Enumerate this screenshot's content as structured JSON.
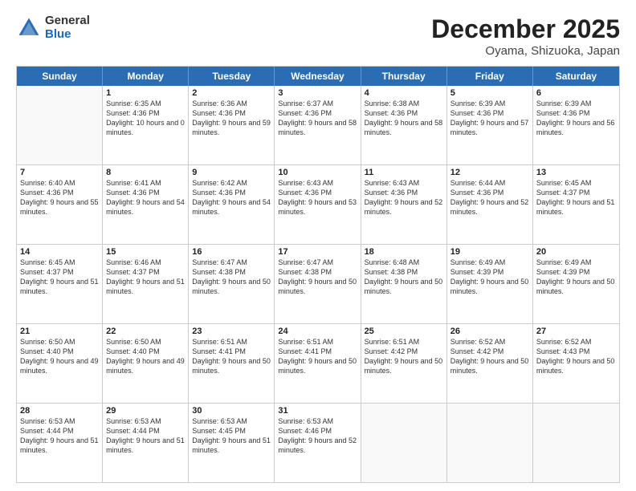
{
  "logo": {
    "general": "General",
    "blue": "Blue"
  },
  "title": "December 2025",
  "location": "Oyama, Shizuoka, Japan",
  "dayHeaders": [
    "Sunday",
    "Monday",
    "Tuesday",
    "Wednesday",
    "Thursday",
    "Friday",
    "Saturday"
  ],
  "weeks": [
    [
      {
        "day": "",
        "empty": true
      },
      {
        "day": "1",
        "sunrise": "Sunrise: 6:35 AM",
        "sunset": "Sunset: 4:36 PM",
        "daylight": "Daylight: 10 hours and 0 minutes."
      },
      {
        "day": "2",
        "sunrise": "Sunrise: 6:36 AM",
        "sunset": "Sunset: 4:36 PM",
        "daylight": "Daylight: 9 hours and 59 minutes."
      },
      {
        "day": "3",
        "sunrise": "Sunrise: 6:37 AM",
        "sunset": "Sunset: 4:36 PM",
        "daylight": "Daylight: 9 hours and 58 minutes."
      },
      {
        "day": "4",
        "sunrise": "Sunrise: 6:38 AM",
        "sunset": "Sunset: 4:36 PM",
        "daylight": "Daylight: 9 hours and 58 minutes."
      },
      {
        "day": "5",
        "sunrise": "Sunrise: 6:39 AM",
        "sunset": "Sunset: 4:36 PM",
        "daylight": "Daylight: 9 hours and 57 minutes."
      },
      {
        "day": "6",
        "sunrise": "Sunrise: 6:39 AM",
        "sunset": "Sunset: 4:36 PM",
        "daylight": "Daylight: 9 hours and 56 minutes."
      }
    ],
    [
      {
        "day": "7",
        "sunrise": "Sunrise: 6:40 AM",
        "sunset": "Sunset: 4:36 PM",
        "daylight": "Daylight: 9 hours and 55 minutes."
      },
      {
        "day": "8",
        "sunrise": "Sunrise: 6:41 AM",
        "sunset": "Sunset: 4:36 PM",
        "daylight": "Daylight: 9 hours and 54 minutes."
      },
      {
        "day": "9",
        "sunrise": "Sunrise: 6:42 AM",
        "sunset": "Sunset: 4:36 PM",
        "daylight": "Daylight: 9 hours and 54 minutes."
      },
      {
        "day": "10",
        "sunrise": "Sunrise: 6:43 AM",
        "sunset": "Sunset: 4:36 PM",
        "daylight": "Daylight: 9 hours and 53 minutes."
      },
      {
        "day": "11",
        "sunrise": "Sunrise: 6:43 AM",
        "sunset": "Sunset: 4:36 PM",
        "daylight": "Daylight: 9 hours and 52 minutes."
      },
      {
        "day": "12",
        "sunrise": "Sunrise: 6:44 AM",
        "sunset": "Sunset: 4:36 PM",
        "daylight": "Daylight: 9 hours and 52 minutes."
      },
      {
        "day": "13",
        "sunrise": "Sunrise: 6:45 AM",
        "sunset": "Sunset: 4:37 PM",
        "daylight": "Daylight: 9 hours and 51 minutes."
      }
    ],
    [
      {
        "day": "14",
        "sunrise": "Sunrise: 6:45 AM",
        "sunset": "Sunset: 4:37 PM",
        "daylight": "Daylight: 9 hours and 51 minutes."
      },
      {
        "day": "15",
        "sunrise": "Sunrise: 6:46 AM",
        "sunset": "Sunset: 4:37 PM",
        "daylight": "Daylight: 9 hours and 51 minutes."
      },
      {
        "day": "16",
        "sunrise": "Sunrise: 6:47 AM",
        "sunset": "Sunset: 4:38 PM",
        "daylight": "Daylight: 9 hours and 50 minutes."
      },
      {
        "day": "17",
        "sunrise": "Sunrise: 6:47 AM",
        "sunset": "Sunset: 4:38 PM",
        "daylight": "Daylight: 9 hours and 50 minutes."
      },
      {
        "day": "18",
        "sunrise": "Sunrise: 6:48 AM",
        "sunset": "Sunset: 4:38 PM",
        "daylight": "Daylight: 9 hours and 50 minutes."
      },
      {
        "day": "19",
        "sunrise": "Sunrise: 6:49 AM",
        "sunset": "Sunset: 4:39 PM",
        "daylight": "Daylight: 9 hours and 50 minutes."
      },
      {
        "day": "20",
        "sunrise": "Sunrise: 6:49 AM",
        "sunset": "Sunset: 4:39 PM",
        "daylight": "Daylight: 9 hours and 50 minutes."
      }
    ],
    [
      {
        "day": "21",
        "sunrise": "Sunrise: 6:50 AM",
        "sunset": "Sunset: 4:40 PM",
        "daylight": "Daylight: 9 hours and 49 minutes."
      },
      {
        "day": "22",
        "sunrise": "Sunrise: 6:50 AM",
        "sunset": "Sunset: 4:40 PM",
        "daylight": "Daylight: 9 hours and 49 minutes."
      },
      {
        "day": "23",
        "sunrise": "Sunrise: 6:51 AM",
        "sunset": "Sunset: 4:41 PM",
        "daylight": "Daylight: 9 hours and 50 minutes."
      },
      {
        "day": "24",
        "sunrise": "Sunrise: 6:51 AM",
        "sunset": "Sunset: 4:41 PM",
        "daylight": "Daylight: 9 hours and 50 minutes."
      },
      {
        "day": "25",
        "sunrise": "Sunrise: 6:51 AM",
        "sunset": "Sunset: 4:42 PM",
        "daylight": "Daylight: 9 hours and 50 minutes."
      },
      {
        "day": "26",
        "sunrise": "Sunrise: 6:52 AM",
        "sunset": "Sunset: 4:42 PM",
        "daylight": "Daylight: 9 hours and 50 minutes."
      },
      {
        "day": "27",
        "sunrise": "Sunrise: 6:52 AM",
        "sunset": "Sunset: 4:43 PM",
        "daylight": "Daylight: 9 hours and 50 minutes."
      }
    ],
    [
      {
        "day": "28",
        "sunrise": "Sunrise: 6:53 AM",
        "sunset": "Sunset: 4:44 PM",
        "daylight": "Daylight: 9 hours and 51 minutes."
      },
      {
        "day": "29",
        "sunrise": "Sunrise: 6:53 AM",
        "sunset": "Sunset: 4:44 PM",
        "daylight": "Daylight: 9 hours and 51 minutes."
      },
      {
        "day": "30",
        "sunrise": "Sunrise: 6:53 AM",
        "sunset": "Sunset: 4:45 PM",
        "daylight": "Daylight: 9 hours and 51 minutes."
      },
      {
        "day": "31",
        "sunrise": "Sunrise: 6:53 AM",
        "sunset": "Sunset: 4:46 PM",
        "daylight": "Daylight: 9 hours and 52 minutes."
      },
      {
        "day": "",
        "empty": true
      },
      {
        "day": "",
        "empty": true
      },
      {
        "day": "",
        "empty": true
      }
    ]
  ]
}
